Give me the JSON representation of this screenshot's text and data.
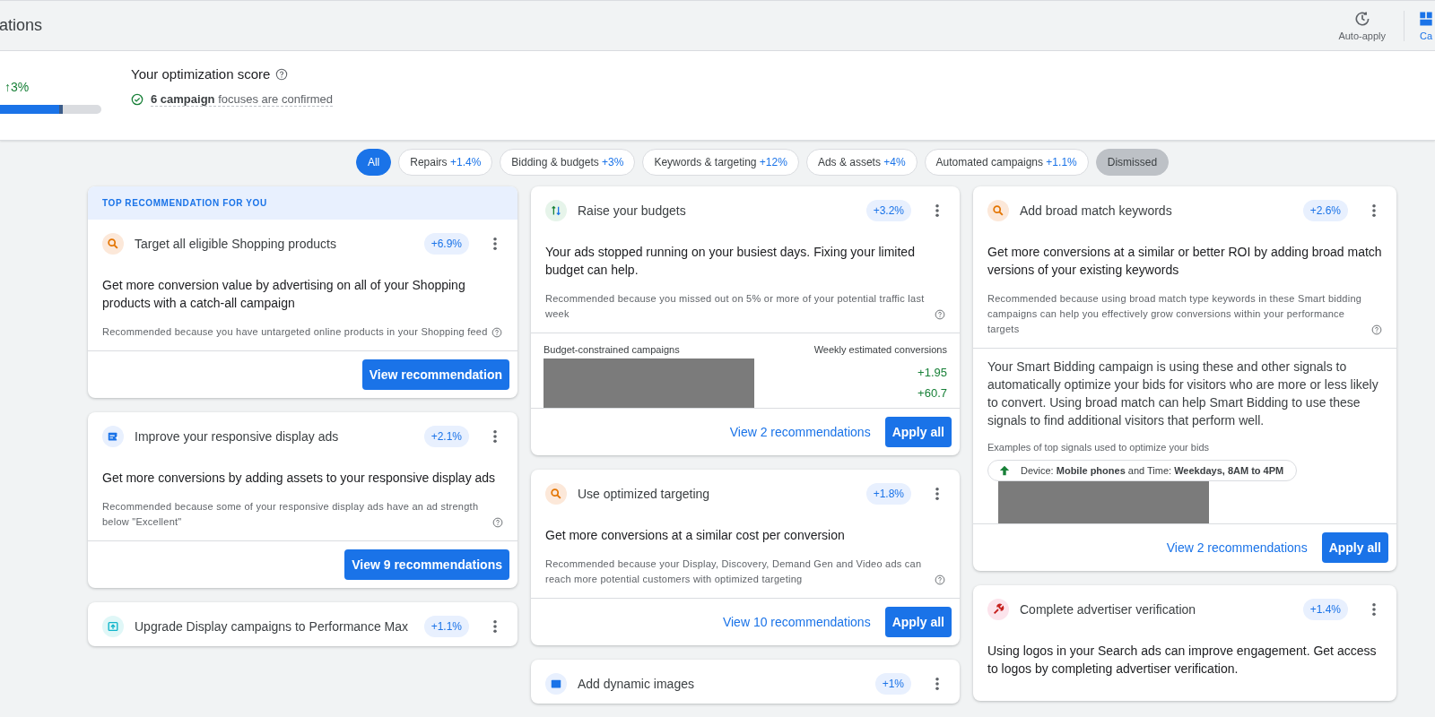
{
  "header": {
    "title": "ations",
    "actions": [
      {
        "label": "Auto-apply",
        "kind": "clock",
        "selected": false
      },
      {
        "label": "Ca",
        "kind": "cards",
        "selected": true
      }
    ]
  },
  "score": {
    "change": "↑3%",
    "level": 0.72,
    "title": "Your optimization score",
    "status": "**6 campaign** focuses are confirmed"
  },
  "filters": [
    {
      "kind": "all",
      "label": "All",
      "selected": true
    },
    {
      "kind": "category",
      "label": "Repairs",
      "uplift": "+1.4%",
      "selected": false
    },
    {
      "kind": "category",
      "label": "Bidding & budgets",
      "uplift": "+3%",
      "selected": false
    },
    {
      "kind": "category",
      "label": "Keywords & targeting",
      "uplift": "+12%",
      "selected": false
    },
    {
      "kind": "category",
      "label": "Ads & assets",
      "uplift": "+4%",
      "selected": false
    },
    {
      "kind": "category",
      "label": "Automated campaigns",
      "uplift": "+1.1%",
      "selected": false
    },
    {
      "kind": "dismissed",
      "label": "Dismissed",
      "selected": false
    }
  ],
  "columns": [
    [
      {
        "banner": "TOP RECOMMENDATION FOR YOU",
        "kind": "search",
        "title": "Target all eligible Shopping products",
        "uplift": "+6.9%",
        "headline": "Get more conversion value by advertising on all of your Shopping products with a catch-all campaign",
        "reason": "Recommended because you have untargeted online products in your Shopping feed",
        "button": "View recommendation"
      },
      {
        "kind": "display",
        "title": "Improve your responsive display ads",
        "uplift": "+2.1%",
        "headline": "Get more conversions by adding assets to your responsive display ads",
        "reason": "Recommended because some of your responsive display ads have an ad strength below \"Excellent\"",
        "button": "View 9 recommendations"
      },
      {
        "kind": "upgrade",
        "title": "Upgrade Display campaigns to Performance Max",
        "uplift": "+1.1%"
      }
    ],
    [
      {
        "kind": "budget",
        "title": "Raise your budgets",
        "uplift": "+3.2%",
        "headline": "Your ads stopped running on your busiest days. Fixing your limited budget can help.",
        "reason": "Recommended because you missed out on 5% or more of your potential traffic last week",
        "table": {
          "left_heading": "Budget-constrained campaigns",
          "right_heading": "Weekly estimated conversions",
          "values": [
            "+1.95",
            "+60.7"
          ]
        },
        "link": "View 2 recommendations",
        "button": "Apply all"
      },
      {
        "kind": "search",
        "title": "Use optimized targeting",
        "uplift": "+1.8%",
        "headline": "Get more conversions at a similar cost per conversion",
        "reason": "Recommended because your Display, Discovery, Demand Gen and Video ads can reach more potential customers with optimized targeting",
        "link": "View 10 recommendations",
        "button": "Apply all"
      },
      {
        "kind": "image",
        "title": "Add dynamic images",
        "uplift": "+1%"
      }
    ],
    [
      {
        "kind": "search",
        "title": "Add broad match keywords",
        "uplift": "+2.6%",
        "headline": "Get more conversions at a similar or better ROI by adding broad match versions of your existing keywords",
        "reason": "Recommended because using broad match type keywords in these Smart bidding campaigns can help you effectively grow conversions within your performance targets",
        "signals": {
          "text": "Your Smart Bidding campaign is using these and other signals to automatically optimize your bids for visitors who are more or less likely to convert. Using broad match can help Smart Bidding to use these signals to find additional visitors that perform well.",
          "caption": "Examples of top signals used to optimize your bids",
          "chips": [
            "Device: **Mobile phones** and Time: **Weekdays, 8AM to 4PM**"
          ]
        },
        "link": "View 2 recommendations",
        "button": "Apply all"
      },
      {
        "kind": "wrench",
        "title": "Complete advertiser verification",
        "uplift": "+1.4%",
        "headline": "Using logos in your Search ads can improve engagement. Get access to logos by completing advertiser verification."
      }
    ]
  ]
}
